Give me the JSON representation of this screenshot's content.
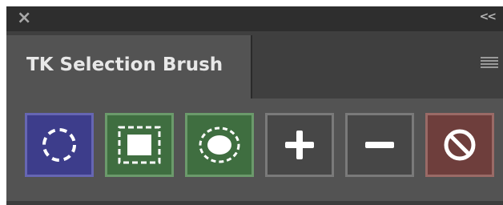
{
  "panel": {
    "close_icon": "close-icon",
    "collapse_icon": "collapse-double-chevron-icon",
    "tab_title": "TK Selection Brush",
    "menu_icon": "panel-menu-icon"
  },
  "tools": [
    {
      "name": "ellipse-selection-tool",
      "icon": "dashed-circle-icon",
      "fill": "#3d3d8b",
      "border": "#6666b3"
    },
    {
      "name": "rectangle-selection-tool",
      "icon": "dashed-square-icon",
      "fill": "#3f6e40",
      "border": "#6b9a6b"
    },
    {
      "name": "oval-selection-tool",
      "icon": "dashed-oval-icon",
      "fill": "#3f6e40",
      "border": "#6b9a6b"
    },
    {
      "name": "add-to-selection-tool",
      "icon": "plus-icon",
      "fill": "#474747",
      "border": "#7a7a7a"
    },
    {
      "name": "subtract-from-selection-tool",
      "icon": "minus-icon",
      "fill": "#474747",
      "border": "#7a7a7a"
    },
    {
      "name": "deselect-tool",
      "icon": "prohibit-icon",
      "fill": "#6e3e3c",
      "border": "#9a6a66"
    }
  ]
}
